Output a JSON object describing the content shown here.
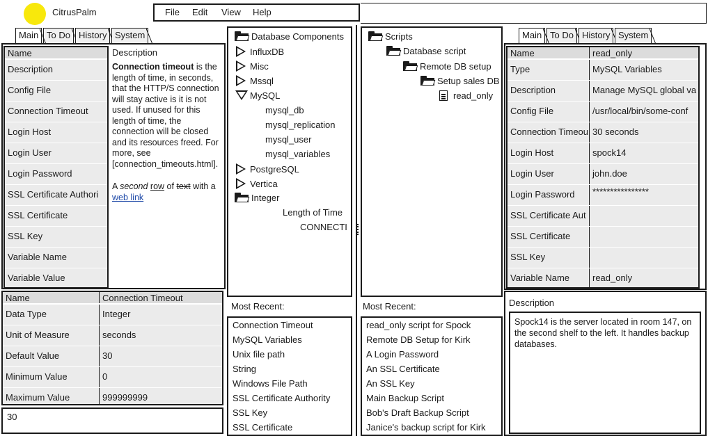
{
  "app": {
    "title": "CitrusPalm"
  },
  "menu": [
    "File",
    "Edit",
    "View",
    "Help"
  ],
  "left_tabs": [
    "Main",
    "To Do",
    "History",
    "System"
  ],
  "right_tabs": [
    "Main",
    "To Do",
    "History",
    "System"
  ],
  "left_props": {
    "header": "Name",
    "items": [
      "Description",
      "Config File",
      "Connection Timeout",
      "Login Host",
      "Login User",
      "Login Password",
      "SSL Certificate Authori",
      "SSL Certificate",
      "SSL Key",
      "Variable Name",
      "Variable  Value"
    ]
  },
  "left_desc": {
    "title": "Description",
    "bold": "Connection timeout",
    "text1": " is the length of time, in seconds, that the HTTP/S connection will stay active is it is not used. If unused for this length of time, the connection will be closed and its resources freed. For more, see [connection_timeouts.html].",
    "p2_a": "A ",
    "p2_italic": "second",
    "p2_b": " ",
    "p2_underline": "row",
    "p2_c": " of ",
    "p2_strike": "text",
    "p2_d": " with a",
    "link": "web link"
  },
  "lower_props": {
    "header": [
      "Name",
      "Connection Timeout"
    ],
    "rows": [
      [
        "Data Type",
        "Integer"
      ],
      [
        "Unit of Measure",
        "seconds"
      ],
      [
        "Default Value",
        "30"
      ],
      [
        "Minimum Value",
        "0"
      ],
      [
        "Maximum Value",
        "999999999"
      ]
    ],
    "input_value": "30"
  },
  "tree1": {
    "items": [
      {
        "label": "Database Components",
        "icon": "folder-open-icon"
      },
      {
        "label": "InfluxDB",
        "icon": "expand-arrow-icon"
      },
      {
        "label": "Misc",
        "icon": "expand-arrow-icon"
      },
      {
        "label": "Mssql",
        "icon": "expand-arrow-icon"
      },
      {
        "label": "MySQL",
        "icon": "collapse-arrow-icon"
      },
      {
        "label": "mysql_db"
      },
      {
        "label": "mysql_replication"
      },
      {
        "label": "mysql_user"
      },
      {
        "label": "mysql_variables"
      },
      {
        "label": "PostgreSQL",
        "icon": "expand-arrow-icon"
      },
      {
        "label": "Vertica",
        "icon": "expand-arrow-icon"
      },
      {
        "label": "Integer",
        "icon": "folder-open-icon"
      },
      {
        "label": "Length of Time"
      },
      {
        "label": "CONNECTI"
      }
    ]
  },
  "recent1": {
    "label": "Most Recent:",
    "items": [
      "Connection Timeout",
      "MySQL Variables",
      "Unix file path",
      "String",
      "Windows File Path",
      "SSL Certificate Authority",
      "SSL Key",
      "SSL Certificate"
    ]
  },
  "tree2": {
    "items": [
      {
        "label": "Scripts",
        "icon": "folder-open-icon"
      },
      {
        "label": "Database script",
        "icon": "folder-open-icon"
      },
      {
        "label": "Remote DB setup",
        "icon": "folder-open-icon"
      },
      {
        "label": "Setup sales DB",
        "icon": "folder-open-icon"
      },
      {
        "label": "read_only",
        "icon": "document-icon"
      }
    ]
  },
  "recent2": {
    "label": "Most Recent:",
    "items": [
      "read_only script for Spock",
      "Remote DB Setup for Kirk",
      "A Login Password",
      "An SSL Certificate",
      "An SSL Key",
      "Main Backup Script",
      "Bob's Draft Backup Script",
      "Janice's backup script for Kirk"
    ]
  },
  "right_props": {
    "rows": [
      [
        "Name",
        "read_only"
      ],
      [
        "Type",
        "MySQL Variables"
      ],
      [
        "Description",
        "Manage MySQL global va"
      ],
      [
        "Config File",
        "/usr/local/bin/some-conf"
      ],
      [
        "Connection Timeou",
        "30 seconds"
      ],
      [
        "Login Host",
        "spock14"
      ],
      [
        "Login User",
        "john.doe"
      ],
      [
        "Login Password",
        "****************"
      ],
      [
        "SSL Certificate Aut",
        ""
      ],
      [
        "SSL Certificate",
        ""
      ],
      [
        "SSL Key",
        ""
      ],
      [
        "Variable Name",
        "read_only"
      ]
    ]
  },
  "right_desc": {
    "label": "Description",
    "text": "Spock14 is the server located in room 147, on the second shelf to the left. It handles backup databases."
  },
  "colors": {
    "logo": "#f8e80c",
    "row_bg": "#ebebeb",
    "link": "#1f4aa8"
  }
}
